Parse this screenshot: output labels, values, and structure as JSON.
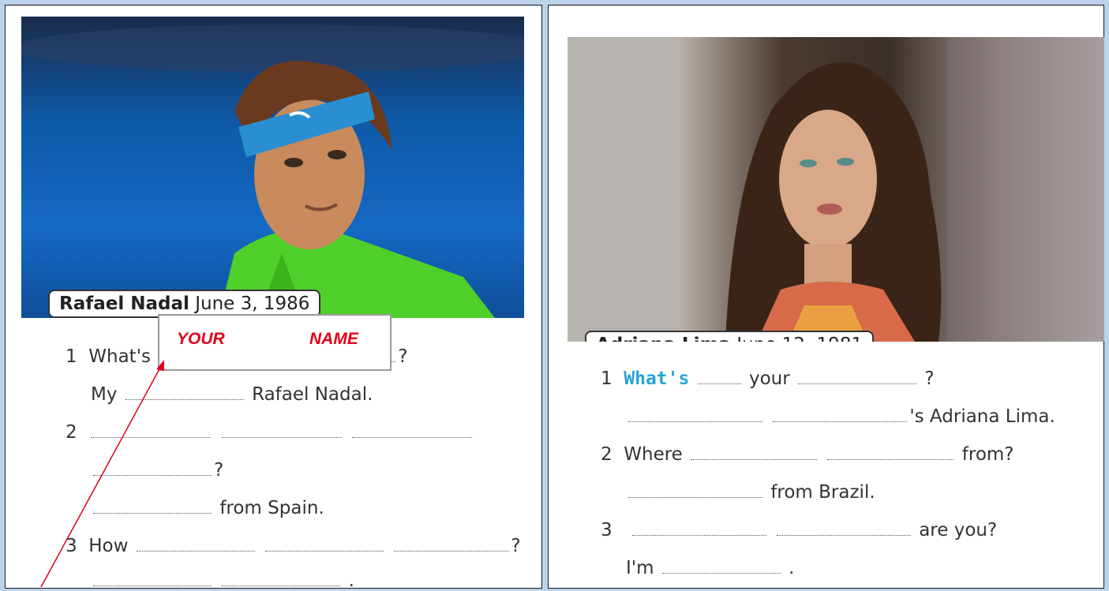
{
  "left": {
    "caption_name": "Rafael Nadal",
    "caption_date": "June 3, 1986",
    "q1_num": "1",
    "q1_text": "What's",
    "q1_end": "?",
    "a1_start": "My",
    "a1_end": "Rafael Nadal.",
    "q2_num": "2",
    "q2_end": "?",
    "a2_end": "from Spain.",
    "q3_num": "3",
    "q3_text": "How",
    "q3_end": "?",
    "a3_end": "."
  },
  "overlay": {
    "word1": "YOUR",
    "word2": "NAME",
    "arrow_color": "#e0001b"
  },
  "right": {
    "caption_name": "Adriana Lima",
    "caption_date": "June 12, 1981",
    "q1_num": "1",
    "q1_answer": "What's",
    "q1_mid": "your",
    "q1_end": "?",
    "a1_end": "'s Adriana Lima.",
    "q2_num": "2",
    "q2_text": "Where",
    "q2_end": "from?",
    "a2_end": "from Brazil.",
    "q3_num": "3",
    "q3_end": "are you?",
    "a3_start": "I'm",
    "a3_end": "."
  },
  "colors": {
    "background": "#bcd4ea",
    "handwriting": "#29a4d6",
    "overlay_text": "#e0001b"
  }
}
